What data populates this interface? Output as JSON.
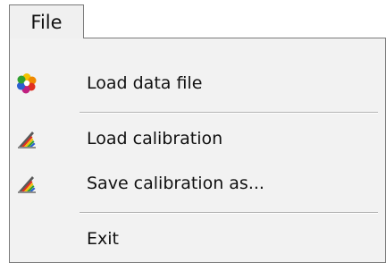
{
  "menubar": {
    "file_label": "File"
  },
  "menu": {
    "items": [
      {
        "label": "Load data file",
        "icon": "color-wheel-icon"
      },
      {
        "label": "Load calibration",
        "icon": "rainbow-ramp-icon"
      },
      {
        "label": "Save calibration as...",
        "icon": "rainbow-ramp-icon"
      },
      {
        "label": "Exit",
        "icon": ""
      }
    ]
  },
  "colors": {
    "menu_background": "#f2f2f2",
    "border": "#7a7a7a",
    "separator": "#b4b4b4"
  }
}
